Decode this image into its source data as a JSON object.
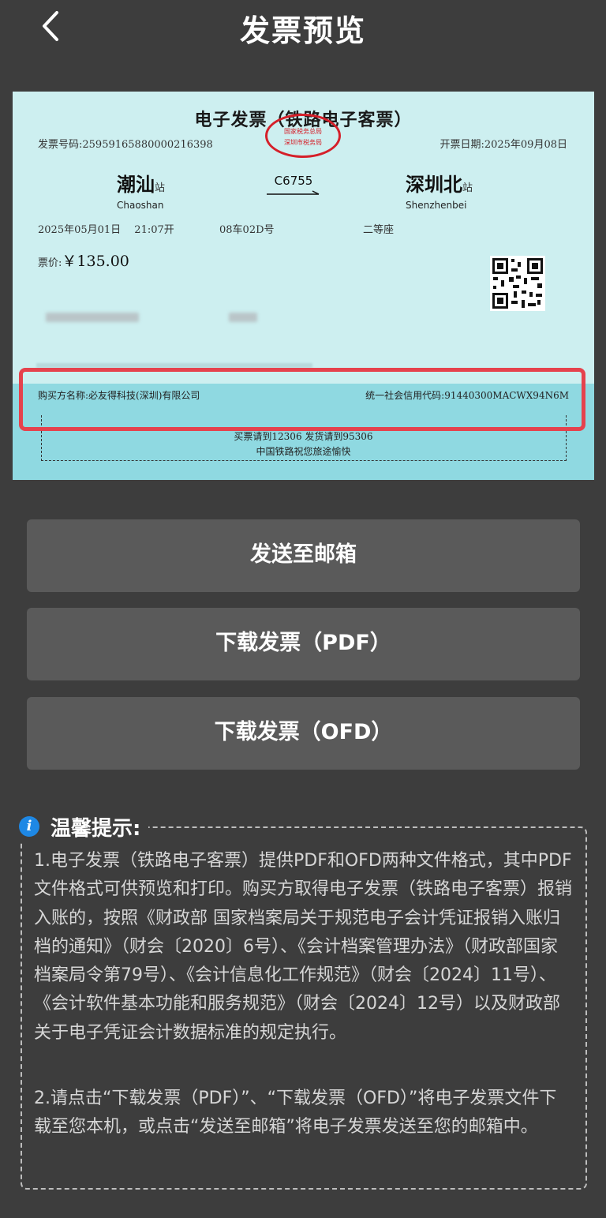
{
  "header": {
    "title": "发票预览",
    "back_icon": "chevron-left-icon"
  },
  "invoice": {
    "title": "电子发票（铁路电子客票）",
    "seal_line1": "国家税务总局",
    "seal_line2": "深圳市税务局",
    "invoice_no": "发票号码:25959165880000216398",
    "issue_date": "开票日期:2025年09月08日",
    "from_station_cn": "潮汕",
    "from_station_suffix": "站",
    "from_station_en": "Chaoshan",
    "train_no": "C6755",
    "to_station_cn": "深圳北",
    "to_station_suffix": "站",
    "to_station_en": "Shenzhenbei",
    "departure": "2025年05月01日　 21:07开",
    "car_seat": "08车02D号",
    "seat_class": "二等座",
    "price_label": "票价:",
    "price_amount": "￥135.00",
    "buyer_name": "购买方名称:必友得科技(深圳)有限公司",
    "credit_code": "统一社会信用代码:91440300MACWX94N6M",
    "footer_line1": "买票请到12306 发货请到95306",
    "footer_line2": "中国铁路祝您旅途愉快",
    "highlight_color": "#e5424d"
  },
  "actions": {
    "email_label": "发送至邮箱",
    "pdf_label": "下载发票（PDF）",
    "ofd_label": "下载发票（OFD）"
  },
  "tips": {
    "icon": "info-icon",
    "title": "温馨提示:",
    "item1": "1.电子发票（铁路电子客票）提供PDF和OFD两种文件格式，其中PDF文件格式可供预览和打印。购买方取得电子发票（铁路电子客票）报销入账的，按照《财政部 国家档案局关于规范电子会计凭证报销入账归档的通知》（财会〔2020〕6号）、《会计档案管理办法》（财政部国家档案局令第79号）、《会计信息化工作规范》（财会〔2024〕11号）、《会计软件基本功能和服务规范》（财会〔2024〕12号）以及财政部关于电子凭证会计数据标准的规定执行。",
    "item2": "2.请点击“下载发票（PDF）”、“下载发票（OFD）”将电子发票文件下载至您本机，或点击“发送至邮箱”将电子发票发送至您的邮箱中。"
  },
  "colors": {
    "background": "#3d3d3d",
    "button": "#5a5a5a",
    "ticket": "#cdeff0",
    "ticket_band": "#8fd9e1",
    "info_icon": "#1e88e5"
  }
}
